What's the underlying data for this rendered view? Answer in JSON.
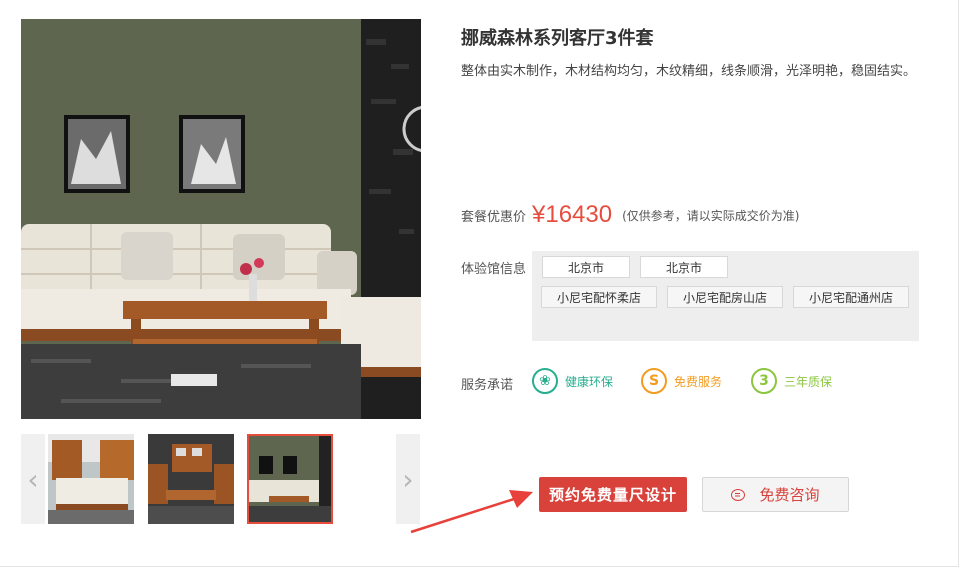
{
  "product": {
    "title": "挪威森林系列客厅3件套",
    "description": "整体由实木制作，木材结构均匀，木纹精细，线条顺滑，光泽明艳，稳固结实。"
  },
  "gallery": {
    "prev_icon": "chevron-left-icon",
    "next_icon": "chevron-right-icon",
    "prev_glyph": "‹",
    "next_glyph": "›",
    "selected_index": 2,
    "thumbnail_count": 3
  },
  "price": {
    "label": "套餐优惠价",
    "value": "¥16430",
    "note": "(仅供参考，请以实际成交价为准)"
  },
  "stores": {
    "label": "体验馆信息",
    "cities": [
      "北京市",
      "北京市"
    ],
    "shops": [
      "小尼宅配怀柔店",
      "小尼宅配房山店",
      "小尼宅配通州店"
    ]
  },
  "services": {
    "label": "服务承诺",
    "items": [
      {
        "text": "健康环保",
        "icon": "leaf-icon",
        "glyph": "❀",
        "color": "#27ae8f"
      },
      {
        "text": "免费服务",
        "icon": "dollar-icon",
        "glyph": "S",
        "color": "#f39c1f"
      },
      {
        "text": "三年质保",
        "icon": "shield-three-icon",
        "glyph": "3",
        "color": "#8cc63f"
      }
    ]
  },
  "actions": {
    "primary_label": "预约免费量尺设计",
    "secondary_label": "免费咨询",
    "secondary_icon": "chat-bubble-icon"
  },
  "colors": {
    "accent": "#e64d3d",
    "button_red": "#d9413b",
    "annotation_arrow": "#e8403a"
  }
}
